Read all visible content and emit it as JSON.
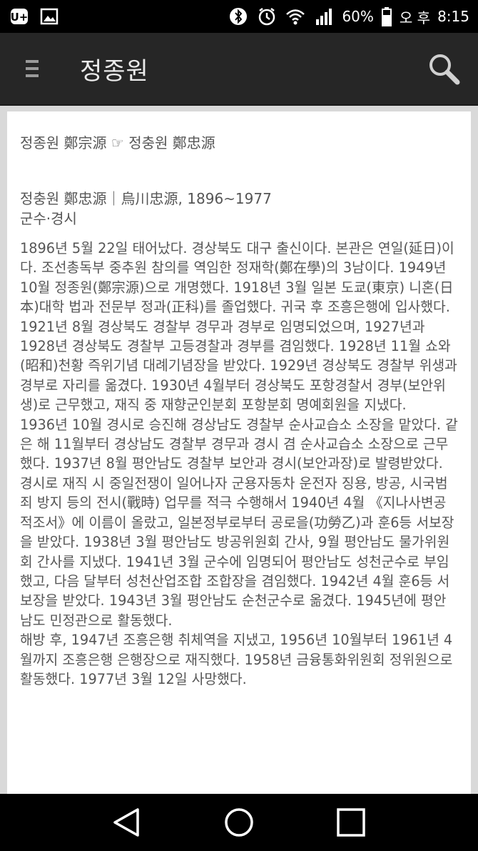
{
  "status_bar": {
    "battery": "60%",
    "ampm": "오 후",
    "time": "8:15"
  },
  "app_bar": {
    "title": "정종원"
  },
  "article": {
    "redirect_line": "정종원 鄭宗源 ☞ 정충원 鄭忠源",
    "heading": "정충원 鄭忠源｜烏川忠源, 1896~1977",
    "subheading": "군수·경시",
    "paragraphs": [
      "1896년 5월 22일 태어났다. 경상북도 대구 출신이다. 본관은 연일(延日)이다. 조선총독부 중추원 참의를 역임한 정재학(鄭在學)의 3남이다. 1949년 10월 정종원(鄭宗源)으로 개명했다. 1918년 3월 일본 도쿄(東京) 니혼(日本)대학 법과 전문부 정과(正科)를 졸업했다. 귀국 후 조흥은행에 입사했다. 1921년 8월 경상북도 경찰부 경무과 경부로 임명되었으며, 1927년과 1928년 경상북도 경찰부 고등경찰과 경부를 겸임했다. 1928년 11월 쇼와(昭和)천황 즉위기념 대례기념장을 받았다. 1929년 경상북도 경찰부 위생과 경부로 자리를 옮겼다. 1930년 4월부터 경상북도 포항경찰서 경부(보안위생)로 근무했고, 재직 중 재향군인분회 포항분회 명예회원을 지냈다.",
      "1936년 10월 경시로 승진해 경상남도 경찰부 순사교습소 소장을 맡았다. 같은 해 11월부터 경상남도 경찰부 경무과 경시 겸 순사교습소 소장으로 근무했다. 1937년 8월 평안남도 경찰부 보안과 경시(보안과장)로 발령받았다. 경시로 재직 시 중일전쟁이 일어나자 군용자동차 운전자 징용, 방공, 시국범죄 방지 등의 전시(戰時) 업무를 적극 수행해서 1940년 4월 《지나사변공적조서》에 이름이 올랐고, 일본정부로부터 공로을(功勞乙)과 훈6등 서보장을 받았다. 1938년 3월 평안남도 방공위원회 간사, 9월 평안남도 물가위원회 간사를 지냈다. 1941년 3월 군수에 임명되어 평안남도 성천군수로 부임했고, 다음 달부터 성천산업조합 조합장을 겸임했다. 1942년 4월 훈6등 서보장을 받았다. 1943년 3월 평안남도 순천군수로 옮겼다. 1945년에 평안남도 민정관으로 활동했다.",
      "해방 후, 1947년 조흥은행 취체역을 지냈고, 1956년 10월부터 1961년 4월까지 조흥은행 은행장으로 재직했다. 1958년 금융통화위원회 정위원으로 활동했다. 1977년 3월 12일 사망했다."
    ]
  }
}
